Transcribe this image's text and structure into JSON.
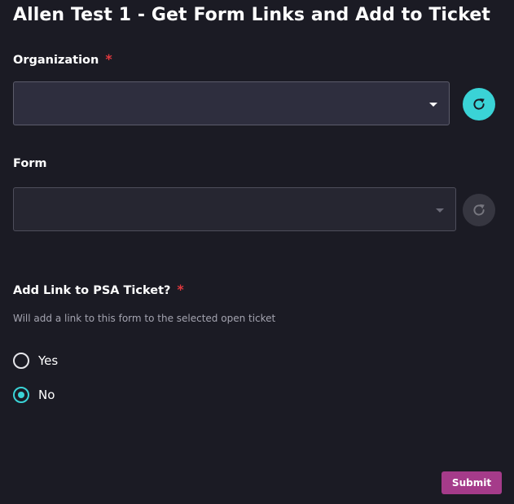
{
  "form": {
    "title": "Allen Test 1 - Get Form Links and Add to Ticket",
    "required_marker": "*",
    "fields": {
      "organization": {
        "label": "Organization",
        "required": true,
        "value": "",
        "enabled": true
      },
      "form": {
        "label": "Form",
        "required": false,
        "value": "",
        "enabled": false
      },
      "add_link": {
        "label": "Add Link to PSA Ticket?",
        "required": true,
        "hint": "Will add a link to this form to the selected open ticket",
        "options": [
          {
            "label": "Yes",
            "selected": false
          },
          {
            "label": "No",
            "selected": true
          }
        ]
      }
    },
    "submit_label": "Submit"
  },
  "icons": {
    "refresh": "refresh-icon",
    "dropdown": "chevron-down-icon"
  },
  "colors": {
    "background": "#1b1b24",
    "accent": "#3ad3d6",
    "required": "#e0383e",
    "submit": "#a53b8a"
  }
}
